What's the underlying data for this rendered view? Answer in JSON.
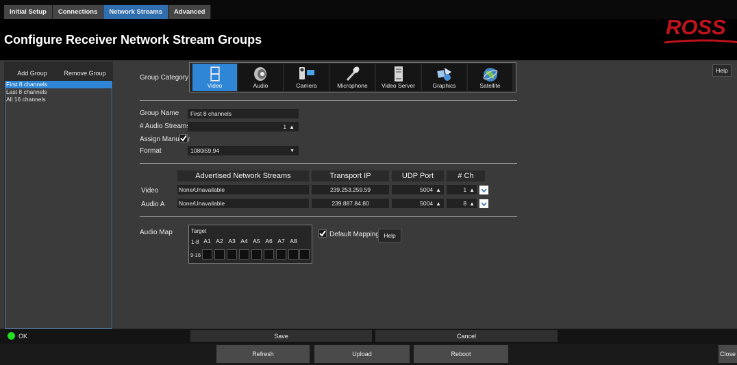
{
  "tabs": [
    {
      "label": "Initial Setup",
      "active": false
    },
    {
      "label": "Connections",
      "active": false
    },
    {
      "label": "Network Streams",
      "active": true
    },
    {
      "label": "Advanced",
      "active": false
    }
  ],
  "page_title": "Configure Receiver Network Stream Groups",
  "brand": {
    "logo_text": "ROSS",
    "logo_color": "#c0121c"
  },
  "sidebar": {
    "add_label": "Add Group",
    "remove_label": "Remove Group",
    "groups": [
      {
        "label": "First 8 channels",
        "selected": true
      },
      {
        "label": "Last 8 channels",
        "selected": false
      },
      {
        "label": "All 16 channels",
        "selected": false
      }
    ]
  },
  "help_label": "Help",
  "category": {
    "label": "Group Category",
    "items": [
      {
        "label": "Video",
        "icon": "video-icon",
        "active": true
      },
      {
        "label": "Audio",
        "icon": "speaker-icon",
        "active": false
      },
      {
        "label": "Camera",
        "icon": "camera-icon",
        "active": false
      },
      {
        "label": "Microphone",
        "icon": "microphone-icon",
        "active": false
      },
      {
        "label": "Video Server",
        "icon": "server-icon",
        "active": false
      },
      {
        "label": "Graphics",
        "icon": "graphics-icon",
        "active": false
      },
      {
        "label": "Satellite",
        "icon": "satellite-icon",
        "active": false
      }
    ]
  },
  "form": {
    "group_name_label": "Group Name",
    "group_name_value": "First 8 channels",
    "audio_streams_label": "# Audio Streams",
    "audio_streams_value": "1",
    "assign_manually_label": "Assign Manually",
    "assign_manually_checked": true,
    "format_label": "Format",
    "format_value": "1080i59.94"
  },
  "streams": {
    "headers": {
      "advertised": "Advertised Network Streams",
      "ip": "Transport IP",
      "port": "UDP Port",
      "ch": "# Ch"
    },
    "rows": [
      {
        "label": "Video",
        "stream": "None/Unavailable",
        "ip": "239.253.259.59",
        "port": "5004",
        "ch": "1"
      },
      {
        "label": "Audio A",
        "stream": "None/Unavailable",
        "ip": "239.887.84.80",
        "port": "5004",
        "ch": "8"
      }
    ]
  },
  "audio_map": {
    "label": "Audio Map",
    "target_label": "Target",
    "row1_label": "1-8",
    "row2_label": "9-16",
    "channels": [
      "A1",
      "A2",
      "A3",
      "A4",
      "A5",
      "A6",
      "A7",
      "A8"
    ],
    "default_mapping_label": "Default Mapping",
    "default_mapping_checked": true,
    "help_label": "Help"
  },
  "status": {
    "text": "OK",
    "color": "#22dd22"
  },
  "actions": {
    "save": "Save",
    "cancel": "Cancel"
  },
  "footer": {
    "refresh": "Refresh",
    "upload": "Upload",
    "reboot": "Reboot",
    "close": "Close"
  }
}
